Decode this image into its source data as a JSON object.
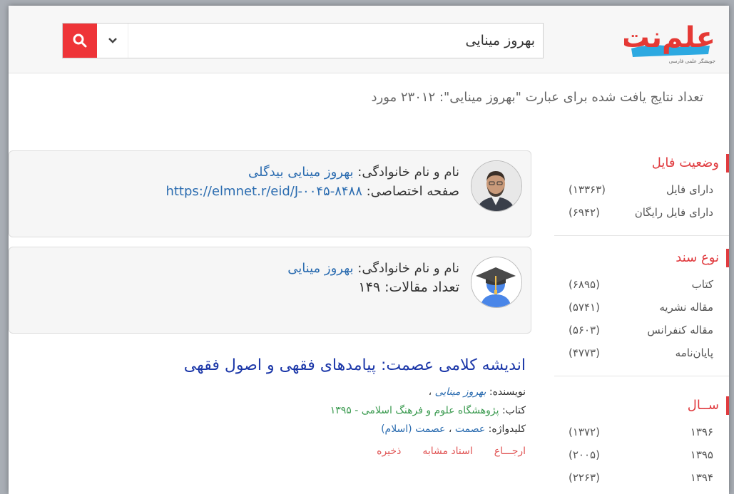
{
  "search": {
    "query": "بهروز مینایی"
  },
  "logo": {
    "brand": "علم‌نت",
    "tagline": "جویشگر علمی فارسی"
  },
  "results_count_text": "تعداد نتایج یافت شده برای عبارت \"بهروز مینایی\": ۲۳۰۱۲ مورد",
  "cards": [
    {
      "name_label": "نام و نام خانوادگی:",
      "name_value": "بهروز مینایی بیدگلی",
      "extra_label": "صفحه اختصاصی:",
      "extra_value": "https://elmnet.r/eid/J-۰۰۴۵-۸۴۸۸"
    },
    {
      "name_label": "نام و نام خانوادگی:",
      "name_value": "بهروز مینایی",
      "extra_label": "تعداد مقالات:",
      "extra_value": "۱۴۹"
    }
  ],
  "result": {
    "title": "اندیشه کلامی عصمت: پیامدهای فقهی و اصول فقهی",
    "author_label": "نویسنده:",
    "author": "بهروز مینایی",
    "author_sep": "،",
    "book_label": "کتاب:",
    "book": "پژوهشگاه علوم و فرهنگ اسلامی - ۱۳۹۵",
    "keywords_label": "کلیدواژه:",
    "keyword1": "عصمت",
    "keyword_sep": "،",
    "keyword2": "عصمت (اسلام)",
    "actions": {
      "cite": "ارجـــاع",
      "similar": "اسناد مشابه",
      "save": "ذخیره"
    }
  },
  "sidebar": {
    "file_status": {
      "title": "وضعیت فایل",
      "items": [
        {
          "label": "دارای فایل",
          "count": "(۱۳۳۶۳)"
        },
        {
          "label": "دارای فایل رایگان",
          "count": "(۶۹۴۲)"
        }
      ]
    },
    "doc_type": {
      "title": "نوع سند",
      "items": [
        {
          "label": "کتاب",
          "count": "(۶۸۹۵)"
        },
        {
          "label": "مقاله نشریه",
          "count": "(۵۷۴۱)"
        },
        {
          "label": "مقاله کنفرانس",
          "count": "(۵۶۰۳)"
        },
        {
          "label": "پایان‌نامه",
          "count": "(۴۷۷۳)"
        }
      ]
    },
    "year": {
      "title": "ســال",
      "items": [
        {
          "label": "۱۳۹۶",
          "count": "(۱۳۷۲)"
        },
        {
          "label": "۱۳۹۵",
          "count": "(۲۰۰۵)"
        },
        {
          "label": "۱۳۹۴",
          "count": "(۲۲۶۳)"
        }
      ]
    }
  },
  "colors": {
    "accent": "#e03a3e",
    "link": "#2b6cb0",
    "title": "#1a36a8",
    "green": "#3a9a4f"
  }
}
